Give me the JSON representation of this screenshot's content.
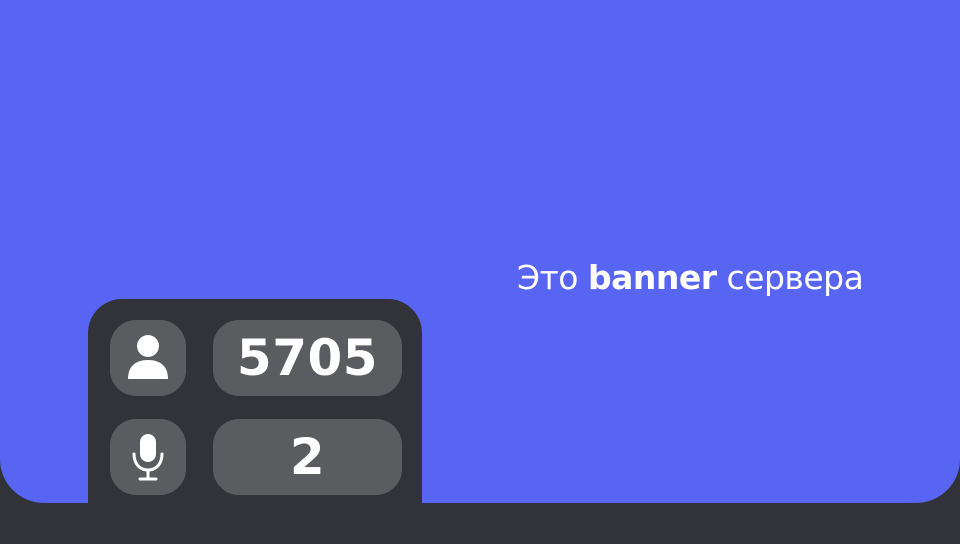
{
  "banner": {
    "text_prefix": "Это",
    "text_bold": "banner",
    "text_suffix": "сервера",
    "background_color": "#5865F2"
  },
  "stats": {
    "members": {
      "icon": "user-icon",
      "count": "5705"
    },
    "voice": {
      "icon": "microphone-icon",
      "count": "2"
    }
  },
  "colors": {
    "page_background": "#313338",
    "stat_box": "#5b5c60",
    "text": "#ffffff"
  }
}
